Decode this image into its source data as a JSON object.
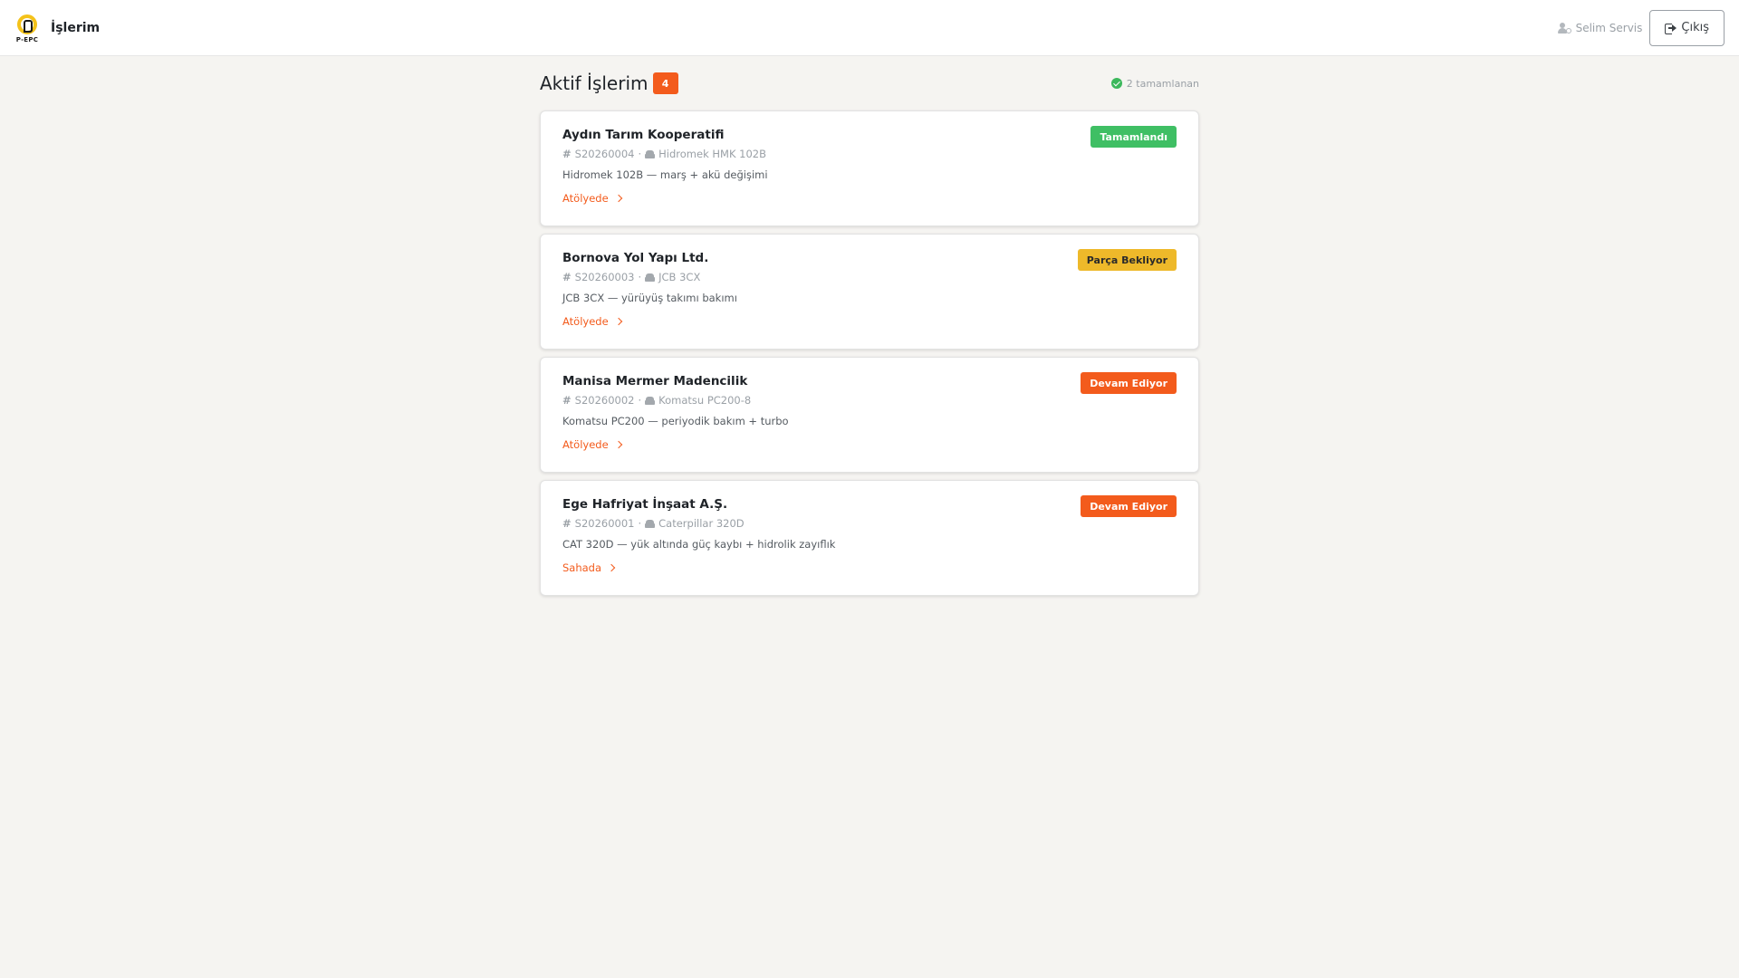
{
  "header": {
    "logo_text": "P-EPC",
    "title": "İşlerim",
    "user_name": "Selim Servis",
    "logout_label": "Çıkış"
  },
  "page": {
    "title": "Aktif İşlerim",
    "active_count": "4",
    "completed_text": "2 tamamlanan"
  },
  "jobs": [
    {
      "customer": "Aydın Tarım Kooperatifi",
      "code": "S20260004",
      "machine": "Hidromek HMK 102B",
      "description": "Hidromek 102B — marş + akü değişimi",
      "location": "Atölyede",
      "status": "Tamamlandı",
      "status_color": "#3fbf64"
    },
    {
      "customer": "Bornova Yol Yapı Ltd.",
      "code": "S20260003",
      "machine": "JCB 3CX",
      "description": "JCB 3CX — yürüyüş takımı bakımı",
      "location": "Atölyede",
      "status": "Parça Bekliyor",
      "status_color": "#eeb92a"
    },
    {
      "customer": "Manisa Mermer Madencilik",
      "code": "S20260002",
      "machine": "Komatsu PC200-8",
      "description": "Komatsu PC200 — periyodik bakım + turbo",
      "location": "Atölyede",
      "status": "Devam Ediyor",
      "status_color": "#f35b1c"
    },
    {
      "customer": "Ege Hafriyat İnşaat A.Ş.",
      "code": "S20260001",
      "machine": "Caterpillar 320D",
      "description": "CAT 320D — yük altında güç kaybı + hidrolik zayıflık",
      "location": "Sahada",
      "status": "Devam Ediyor",
      "status_color": "#f35b1c"
    }
  ]
}
